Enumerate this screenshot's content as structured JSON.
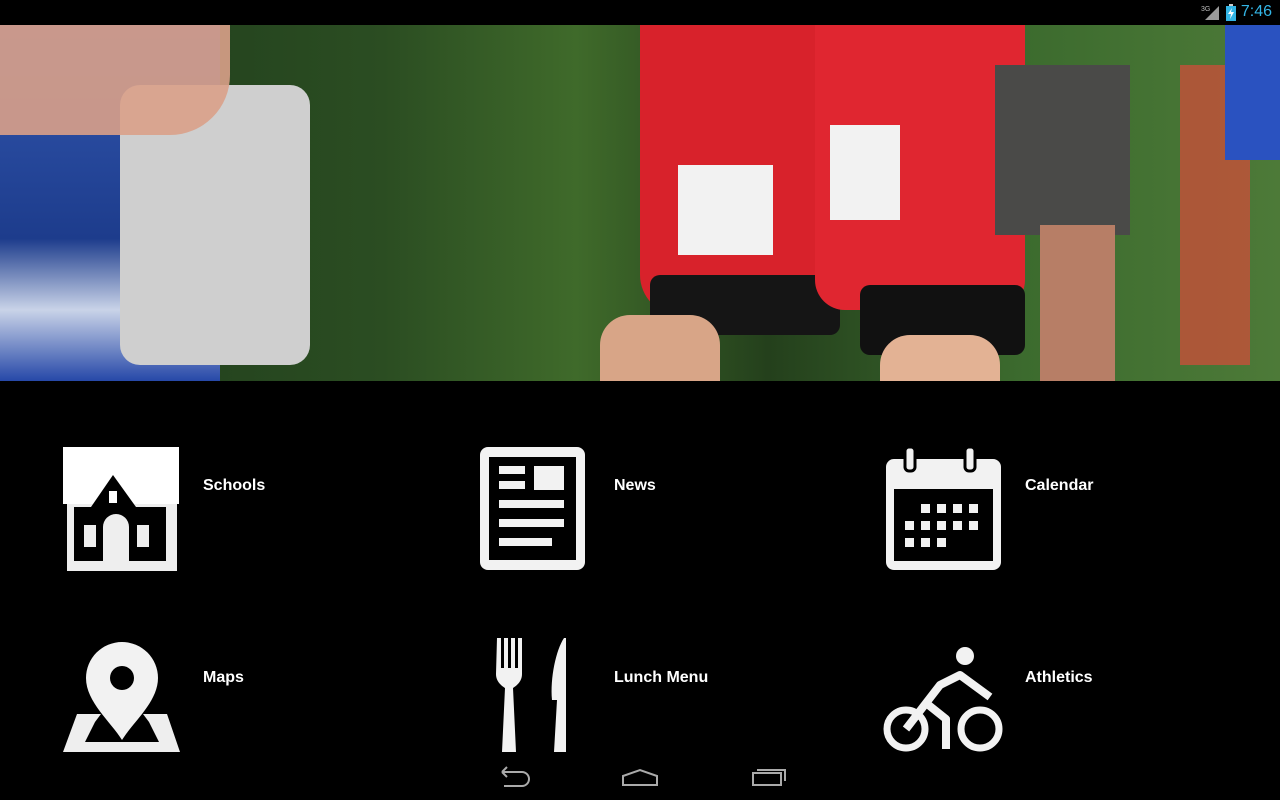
{
  "status_bar": {
    "time": "7:46",
    "network": "3G",
    "icons": [
      "signal-icon",
      "battery-charging-icon"
    ],
    "clock_color": "#33b5e5"
  },
  "hero": {
    "description_icon": "hero-photo"
  },
  "tiles": [
    {
      "label": "Schools",
      "icon": "school-icon"
    },
    {
      "label": "News",
      "icon": "newspaper-icon"
    },
    {
      "label": "Calendar",
      "icon": "calendar-icon"
    },
    {
      "label": "Maps",
      "icon": "map-pin-icon"
    },
    {
      "label": "Lunch Menu",
      "icon": "fork-knife-icon"
    },
    {
      "label": "Athletics",
      "icon": "cyclist-icon"
    }
  ],
  "nav_bar": {
    "buttons": [
      "back-icon",
      "home-icon",
      "recents-icon"
    ]
  }
}
